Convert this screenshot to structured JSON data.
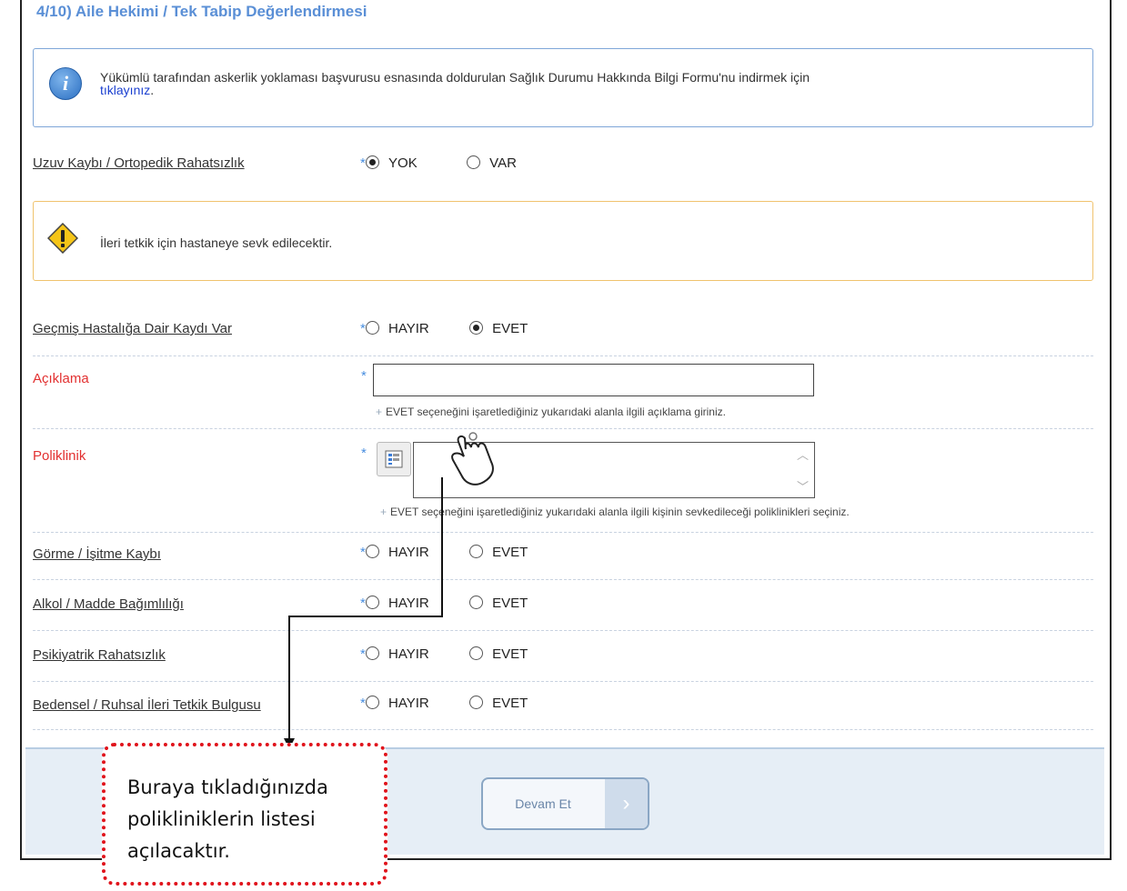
{
  "section_title": "4/10) Aile Hekimi / Tek Tabip Değerlendirmesi",
  "info": {
    "icon": "info-icon",
    "text": "Yükümlü tarafından askerlik yoklaması başvurusu esnasında doldurulan Sağlık Durumu Hakkında Bilgi Formu'nu indirmek için",
    "link": "tıklayınız",
    "link_suffix": "."
  },
  "warning": {
    "icon": "warning-icon",
    "text": "İleri tetkik için hastaneye sevk edilecektir."
  },
  "required_mark": "*",
  "rows": {
    "uzuv": {
      "label": "Uzuv Kaybı / Ortopedik Rahatsızlık",
      "opt1": "YOK",
      "opt2": "VAR",
      "selected": "YOK"
    },
    "gecmis": {
      "label": "Geçmiş Hastalığa Dair Kaydı Var",
      "opt1": "HAYIR",
      "opt2": "EVET",
      "selected": "EVET"
    },
    "aciklama": {
      "label": "Açıklama",
      "value": "",
      "hint": "EVET seçeneğini işaretlediğiniz yukarıdaki alanla ilgili açıklama giriniz."
    },
    "poliklinik": {
      "label": "Poliklinik",
      "value": "",
      "hint": "EVET seçeneğini işaretlediğiniz yukarıdaki alanla ilgili kişinin sevkedileceği poliklinikleri seçiniz."
    },
    "gorme": {
      "label": "Görme / İşitme Kaybı",
      "opt1": "HAYIR",
      "opt2": "EVET",
      "selected": ""
    },
    "alkol": {
      "label": "Alkol / Madde Bağımlılığı",
      "opt1": "HAYIR",
      "opt2": "EVET",
      "selected": ""
    },
    "psikiyatrik": {
      "label": "Psikiyatrik Rahatsızlık",
      "opt1": "HAYIR",
      "opt2": "EVET",
      "selected": ""
    },
    "bedensel": {
      "label": "Bedensel / Ruhsal İleri Tetkik Bulgusu",
      "opt1": "HAYIR",
      "opt2": "EVET",
      "selected": ""
    }
  },
  "continue_button": "Devam Et",
  "callout": "Buraya tıkladığınızda polikliniklerin listesi açılacaktır.",
  "colors": {
    "title": "#5a8fd6",
    "required_label": "#e23030",
    "callout_border": "#e0121b"
  }
}
